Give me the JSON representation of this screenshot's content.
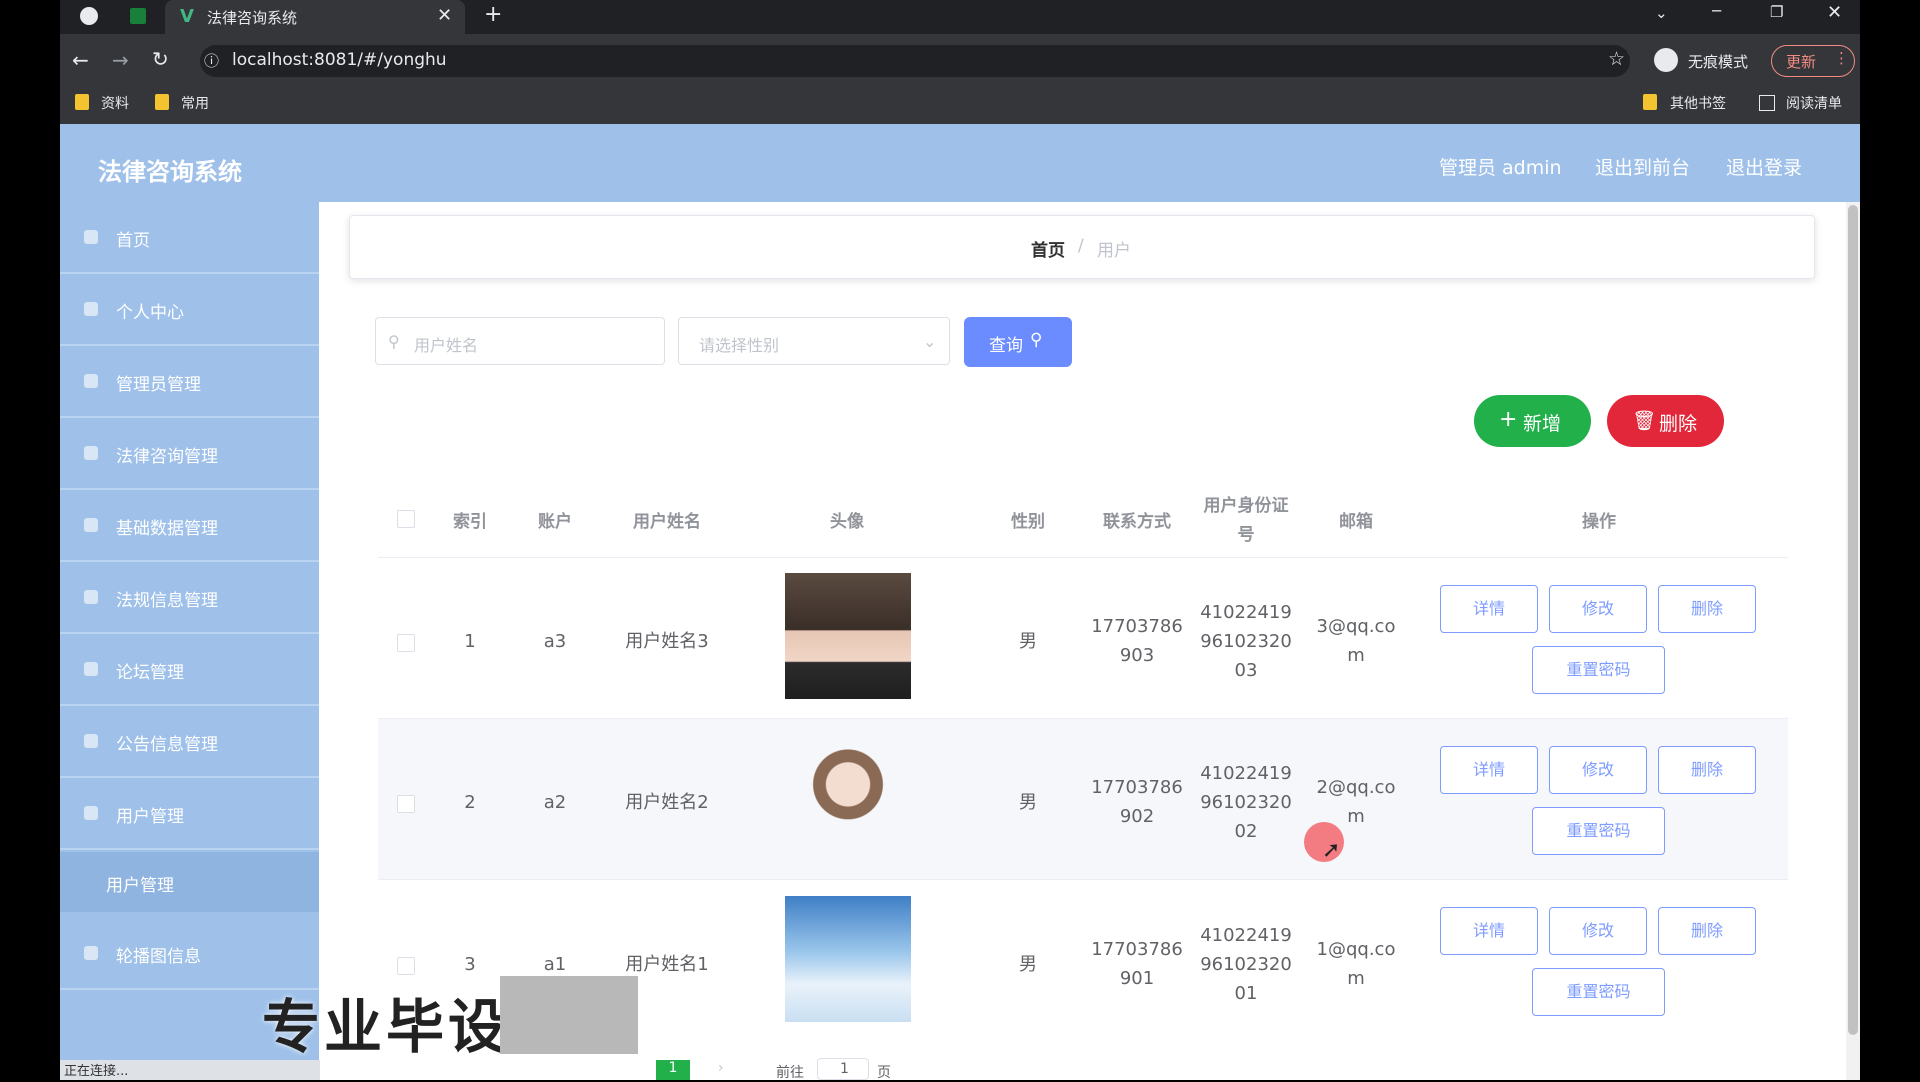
{
  "browser": {
    "tab_title": "法律咨询系统",
    "url": "localhost:8081/#/yonghu",
    "incognito_label": "无痕模式",
    "update_label": "更新",
    "bookmarks": [
      "资料",
      "常用"
    ],
    "bookmarks_right": [
      "其他书签",
      "阅读清单"
    ]
  },
  "header": {
    "title": "法律咨询系统",
    "user_label": "管理员 admin",
    "front_label": "退出到前台",
    "logout_label": "退出登录"
  },
  "sidebar": {
    "items": [
      {
        "label": "首页",
        "icon": "home-icon"
      },
      {
        "label": "个人中心",
        "icon": "user-icon"
      },
      {
        "label": "管理员管理",
        "icon": "admin-icon"
      },
      {
        "label": "法律咨询管理",
        "icon": "consult-icon"
      },
      {
        "label": "基础数据管理",
        "icon": "data-icon"
      },
      {
        "label": "法规信息管理",
        "icon": "law-icon"
      },
      {
        "label": "论坛管理",
        "icon": "forum-icon"
      },
      {
        "label": "公告信息管理",
        "icon": "notice-icon"
      },
      {
        "label": "用户管理",
        "icon": "users-icon"
      }
    ],
    "sub_item": "用户管理",
    "last_item": "轮播图信息"
  },
  "breadcrumb": {
    "home": "首页",
    "sep": "/",
    "current": "用户"
  },
  "search": {
    "name_placeholder": "用户姓名",
    "gender_placeholder": "请选择性别",
    "query_label": "查询"
  },
  "actions": {
    "add_label": "新增",
    "delete_label": "删除"
  },
  "table": {
    "headers": [
      "索引",
      "账户",
      "用户姓名",
      "头像",
      "性别",
      "联系方式",
      "用户身份证号",
      "邮箱",
      "操作"
    ],
    "rows": [
      {
        "index": "1",
        "account": "a3",
        "name": "用户姓名3",
        "gender": "男",
        "phone_a": "17703786",
        "phone_b": "903",
        "id_a": "41022419",
        "id_b": "96102320",
        "id_c": "03",
        "email_a": "3@qq.co",
        "email_b": "m"
      },
      {
        "index": "2",
        "account": "a2",
        "name": "用户姓名2",
        "gender": "男",
        "phone_a": "17703786",
        "phone_b": "902",
        "id_a": "41022419",
        "id_b": "96102320",
        "id_c": "02",
        "email_a": "2@qq.co",
        "email_b": "m"
      },
      {
        "index": "3",
        "account": "a1",
        "name": "用户姓名1",
        "gender": "男",
        "phone_a": "17703786",
        "phone_b": "901",
        "id_a": "41022419",
        "id_b": "96102320",
        "id_c": "01",
        "email_a": "1@qq.co",
        "email_b": "m"
      }
    ],
    "ops": {
      "detail": "详情",
      "edit": "修改",
      "delete": "删除",
      "reset": "重置密码"
    }
  },
  "footer": {
    "status": "正在连接...",
    "page_current": "1",
    "goto_label": "前往",
    "goto_value": "1",
    "page_unit": "页"
  },
  "overlay": {
    "watermark": "专业毕设"
  }
}
